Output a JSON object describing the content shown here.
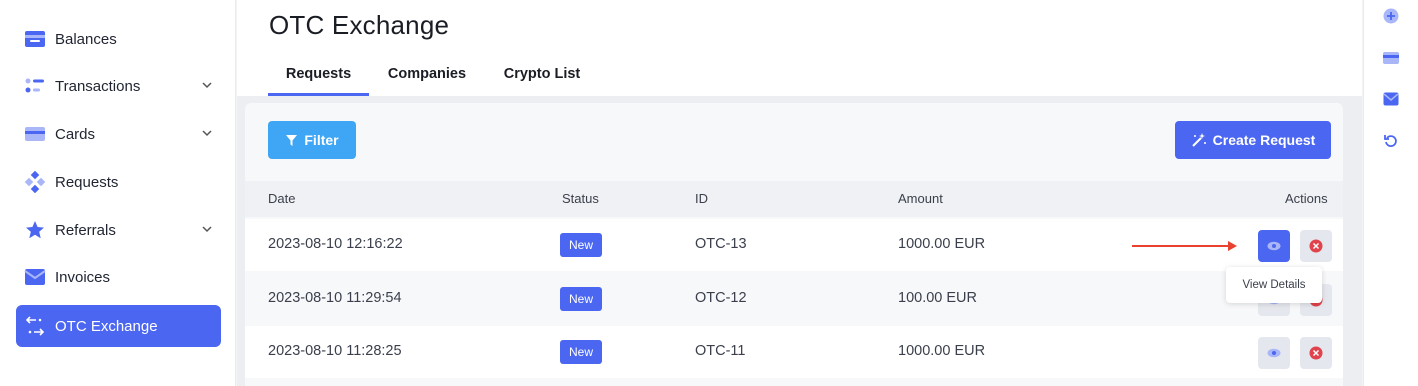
{
  "sidebar": {
    "items": [
      {
        "label": "Balances",
        "icon": "wallet-icon"
      },
      {
        "label": "Transactions",
        "icon": "transactions-icon",
        "expandable": true
      },
      {
        "label": "Cards",
        "icon": "card-icon",
        "expandable": true
      },
      {
        "label": "Requests",
        "icon": "requests-icon"
      },
      {
        "label": "Referrals",
        "icon": "star-icon",
        "expandable": true
      },
      {
        "label": "Invoices",
        "icon": "mail-icon"
      },
      {
        "label": "OTC Exchange",
        "icon": "exchange-icon",
        "active": true
      }
    ]
  },
  "page": {
    "title": "OTC Exchange",
    "tabs": [
      {
        "label": "Requests",
        "active": true
      },
      {
        "label": "Companies"
      },
      {
        "label": "Crypto List"
      }
    ]
  },
  "toolbar": {
    "filter_label": "Filter",
    "create_label": "Create Request"
  },
  "table": {
    "headers": [
      "Date",
      "Status",
      "ID",
      "Amount",
      "Actions"
    ],
    "rows": [
      {
        "date": "2023-08-10 12:16:22",
        "status": "New",
        "id": "OTC-13",
        "amount": "1000.00 EUR"
      },
      {
        "date": "2023-08-10 11:29:54",
        "status": "New",
        "id": "OTC-12",
        "amount": "100.00 EUR"
      },
      {
        "date": "2023-08-10 11:28:25",
        "status": "New",
        "id": "OTC-11",
        "amount": "1000.00 EUR"
      }
    ]
  },
  "tooltip": {
    "text": "View Details"
  },
  "rail": {
    "icons": [
      "plus-icon",
      "card-icon",
      "mail-icon",
      "refresh-icon"
    ]
  },
  "colors": {
    "accent": "#4b66f0",
    "filter": "#3ea6f4",
    "annotation": "#e8412f",
    "delete": "#e0434b"
  }
}
